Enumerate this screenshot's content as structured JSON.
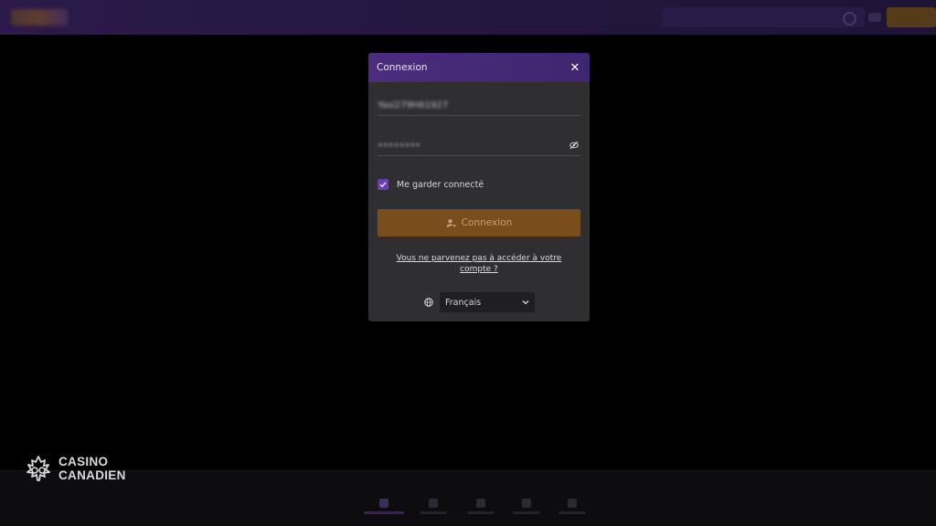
{
  "modal": {
    "title": "Connexion",
    "close_icon": "close-icon",
    "username_value": "Yasi279H61927",
    "password_value": "••••••••",
    "password_toggle_icon": "eye-slash-icon",
    "remember_label": "Me garder connecté",
    "remember_checked": true,
    "login_button_label": "Connexion",
    "login_icon": "user-login-icon",
    "forgot_link_line1": "Vous ne parvenez pas à accéder à votre",
    "forgot_link_line2": "compte ?",
    "language_icon": "globe-icon",
    "language_selected": "Français"
  },
  "watermark": {
    "line1": "CASINO",
    "line2": "CANADIEN"
  },
  "colors": {
    "header_purple": "#4a2d7c",
    "modal_bg": "#2f2f31",
    "login_button": "#7a4e1c",
    "checkbox": "#6b3fb3"
  }
}
